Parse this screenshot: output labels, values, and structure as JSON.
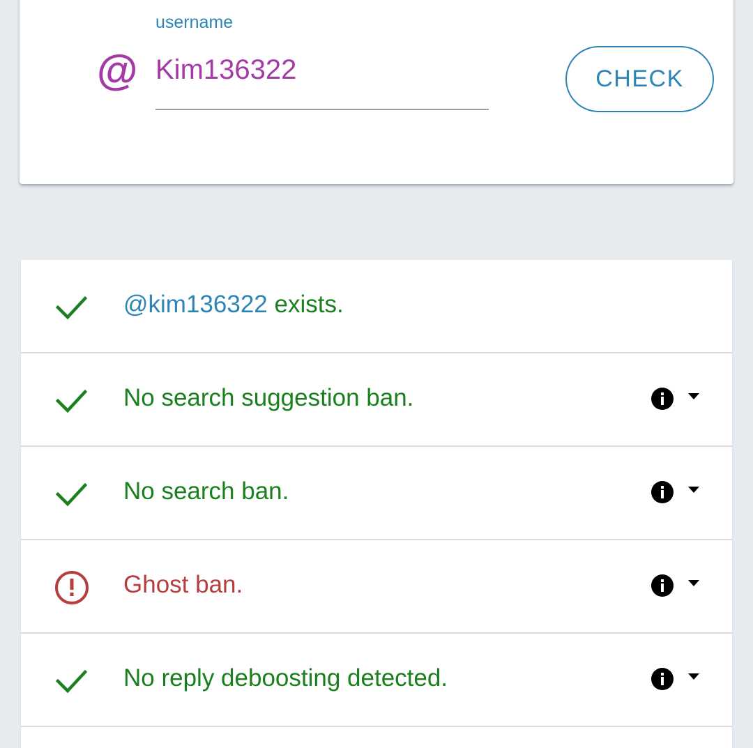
{
  "form": {
    "label": "username",
    "value": "Kim136322",
    "prefix_icon": "at-icon",
    "check_label": "CHECK"
  },
  "results": [
    {
      "status": "ok",
      "handle": "@kim136322",
      "text": " exists.",
      "has_info": false
    },
    {
      "status": "ok",
      "text": "No search suggestion ban.",
      "has_info": true
    },
    {
      "status": "ok",
      "text": "No search ban.",
      "has_info": true
    },
    {
      "status": "error",
      "text": "Ghost ban.",
      "has_info": true
    },
    {
      "status": "ok",
      "text": "No reply deboosting detected.",
      "has_info": true
    }
  ],
  "colors": {
    "accent_blue": "#2c85b4",
    "brand_purple": "#a43aa6",
    "success_green": "#1a801e",
    "error_red": "#b63e3e",
    "background": "#e6ebef"
  },
  "icons": {
    "ok": "checkmark-icon",
    "error": "alert-circle-icon",
    "info": "info-icon",
    "expand": "caret-down-icon"
  }
}
